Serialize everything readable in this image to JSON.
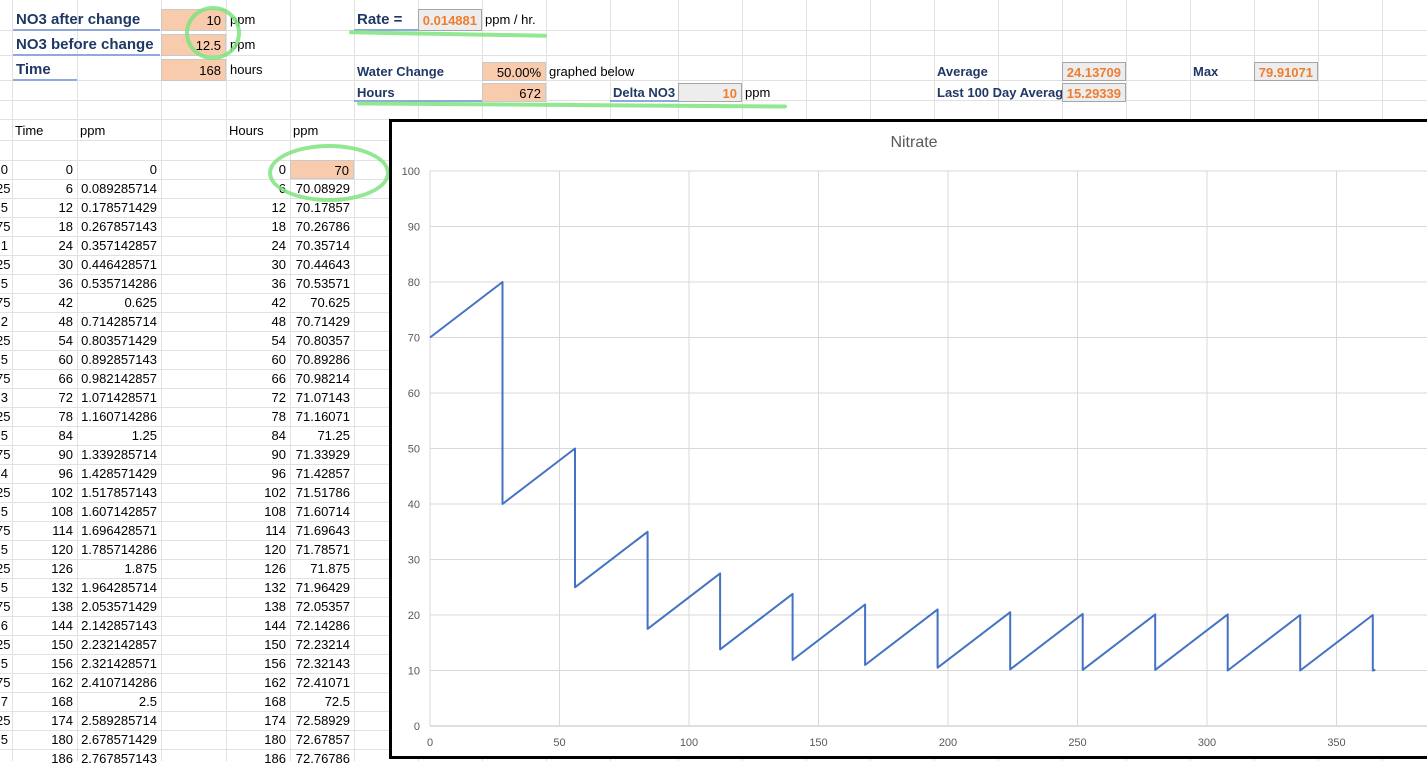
{
  "params": {
    "no3_after_label": "NO3 after change",
    "no3_after_value": "10",
    "no3_after_unit": "ppm",
    "no3_before_label": "NO3 before change",
    "no3_before_value": "12.5",
    "no3_before_unit": "ppm",
    "time_label": "Time",
    "time_value": "168",
    "time_unit": "hours",
    "rate_label": "Rate =",
    "rate_value": "0.014881",
    "rate_unit": "ppm / hr.",
    "water_change_label": "Water Change",
    "water_change_value": "50.00%",
    "water_change_note": "graphed below",
    "hours_label": "Hours",
    "hours_value": "672",
    "delta_label": "Delta NO3",
    "delta_value": "10",
    "delta_unit": "ppm",
    "average_label": "Average",
    "average_value": "24.13709",
    "max_label": "Max",
    "max_value": "79.91071",
    "last100_label": "Last 100 Day Average",
    "last100_value": "15.29339"
  },
  "table": {
    "col_time": "Time",
    "col_ppm": "ppm",
    "col_hours": "Hours",
    "col_ppm2": "ppm",
    "rows": [
      {
        "a": "0",
        "b": "0",
        "c": "0",
        "d": "0",
        "e": "70"
      },
      {
        "a": "25",
        "b": "6",
        "c": "0.089285714",
        "d": "6",
        "e": "70.08929"
      },
      {
        "a": ".5",
        "b": "12",
        "c": "0.178571429",
        "d": "12",
        "e": "70.17857"
      },
      {
        "a": "75",
        "b": "18",
        "c": "0.267857143",
        "d": "18",
        "e": "70.26786"
      },
      {
        "a": "1",
        "b": "24",
        "c": "0.357142857",
        "d": "24",
        "e": "70.35714"
      },
      {
        "a": "25",
        "b": "30",
        "c": "0.446428571",
        "d": "30",
        "e": "70.44643"
      },
      {
        "a": ".5",
        "b": "36",
        "c": "0.535714286",
        "d": "36",
        "e": "70.53571"
      },
      {
        "a": "75",
        "b": "42",
        "c": "0.625",
        "d": "42",
        "e": "70.625"
      },
      {
        "a": "2",
        "b": "48",
        "c": "0.714285714",
        "d": "48",
        "e": "70.71429"
      },
      {
        "a": "25",
        "b": "54",
        "c": "0.803571429",
        "d": "54",
        "e": "70.80357"
      },
      {
        "a": ".5",
        "b": "60",
        "c": "0.892857143",
        "d": "60",
        "e": "70.89286"
      },
      {
        "a": "75",
        "b": "66",
        "c": "0.982142857",
        "d": "66",
        "e": "70.98214"
      },
      {
        "a": "3",
        "b": "72",
        "c": "1.071428571",
        "d": "72",
        "e": "71.07143"
      },
      {
        "a": "25",
        "b": "78",
        "c": "1.160714286",
        "d": "78",
        "e": "71.16071"
      },
      {
        "a": ".5",
        "b": "84",
        "c": "1.25",
        "d": "84",
        "e": "71.25"
      },
      {
        "a": "75",
        "b": "90",
        "c": "1.339285714",
        "d": "90",
        "e": "71.33929"
      },
      {
        "a": "4",
        "b": "96",
        "c": "1.428571429",
        "d": "96",
        "e": "71.42857"
      },
      {
        "a": "25",
        "b": "102",
        "c": "1.517857143",
        "d": "102",
        "e": "71.51786"
      },
      {
        "a": ".5",
        "b": "108",
        "c": "1.607142857",
        "d": "108",
        "e": "71.60714"
      },
      {
        "a": "75",
        "b": "114",
        "c": "1.696428571",
        "d": "114",
        "e": "71.69643"
      },
      {
        "a": "5",
        "b": "120",
        "c": "1.785714286",
        "d": "120",
        "e": "71.78571"
      },
      {
        "a": "25",
        "b": "126",
        "c": "1.875",
        "d": "126",
        "e": "71.875"
      },
      {
        "a": ".5",
        "b": "132",
        "c": "1.964285714",
        "d": "132",
        "e": "71.96429"
      },
      {
        "a": "75",
        "b": "138",
        "c": "2.053571429",
        "d": "138",
        "e": "72.05357"
      },
      {
        "a": "6",
        "b": "144",
        "c": "2.142857143",
        "d": "144",
        "e": "72.14286"
      },
      {
        "a": "25",
        "b": "150",
        "c": "2.232142857",
        "d": "150",
        "e": "72.23214"
      },
      {
        "a": ".5",
        "b": "156",
        "c": "2.321428571",
        "d": "156",
        "e": "72.32143"
      },
      {
        "a": "75",
        "b": "162",
        "c": "2.410714286",
        "d": "162",
        "e": "72.41071"
      },
      {
        "a": "7",
        "b": "168",
        "c": "2.5",
        "d": "168",
        "e": "72.5"
      },
      {
        "a": "25",
        "b": "174",
        "c": "2.589285714",
        "d": "174",
        "e": "72.58929"
      },
      {
        "a": ".5",
        "b": "180",
        "c": "2.678571429",
        "d": "180",
        "e": "72.67857"
      },
      {
        "a": "",
        "b": "186",
        "c": "2.767857143",
        "d": "186",
        "e": "72.76786"
      }
    ]
  },
  "chart_data": {
    "type": "line",
    "title": "Nitrate",
    "xlabel": "",
    "ylabel": "",
    "xlim": [
      0,
      365
    ],
    "ylim": [
      0,
      100
    ],
    "x_ticks": [
      0,
      50,
      100,
      150,
      200,
      250,
      300,
      350
    ],
    "y_ticks": [
      0,
      10,
      20,
      30,
      40,
      50,
      60,
      70,
      80,
      90,
      100
    ],
    "grid": true,
    "line_color": "#4472c4",
    "series": [
      {
        "values": [
          [
            0,
            70
          ],
          [
            28,
            80
          ],
          [
            28,
            40
          ],
          [
            56,
            50
          ],
          [
            56,
            25
          ],
          [
            84,
            35
          ],
          [
            84,
            17.5
          ],
          [
            112,
            27.5
          ],
          [
            112,
            13.8
          ],
          [
            140,
            23.8
          ],
          [
            140,
            11.9
          ],
          [
            168,
            21.9
          ],
          [
            168,
            11
          ],
          [
            196,
            21
          ],
          [
            196,
            10.5
          ],
          [
            224,
            20.5
          ],
          [
            224,
            10.2
          ],
          [
            252,
            20.2
          ],
          [
            252,
            10.1
          ],
          [
            280,
            20.1
          ],
          [
            280,
            10.1
          ],
          [
            308,
            20.1
          ],
          [
            308,
            10
          ],
          [
            336,
            20
          ],
          [
            336,
            10
          ],
          [
            364,
            20
          ],
          [
            364,
            10
          ],
          [
            365,
            10.1
          ]
        ]
      }
    ]
  }
}
